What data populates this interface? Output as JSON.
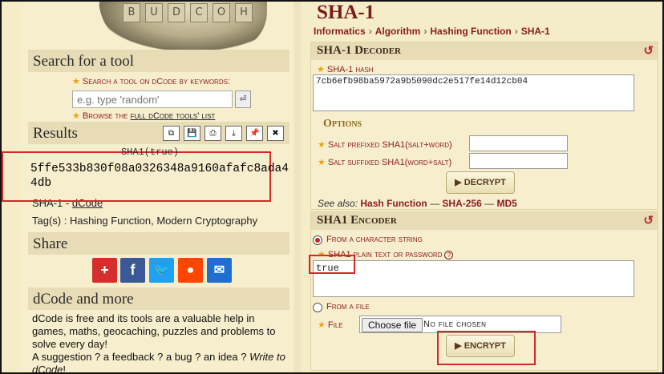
{
  "left": {
    "logo_letters": [
      "B",
      "U",
      "D",
      "C",
      "O",
      "H"
    ],
    "search_title": "Search for a tool",
    "search_hint": "Search a tool on dCode by keywords:",
    "search_placeholder": "e.g. type 'random'",
    "browse_prefix": "Browse the",
    "browse_link": "full dCode tools' list",
    "results_title": "Results",
    "result_label": "SHA1(true)",
    "result_value": "5ffe533b830f08a0326348a9160afafc8ada44db",
    "source_prefix": "SHA-1 -",
    "source_link": "dCode",
    "tags_text": "Tag(s) : Hashing Function, Modern Cryptography",
    "share_title": "Share",
    "about_title": "dCode and more",
    "about_text_1": "dCode is free and its tools are a valuable help in games, maths, geocaching, puzzles and problems to solve every day!",
    "about_text_2a": "A suggestion ? a feedback ? a bug ? an idea ?",
    "about_text_2b": "Write to dCode",
    "about_text_2c": "!"
  },
  "right": {
    "page_title": "SHA-1",
    "breadcrumb": [
      "Informatics",
      "Algorithm",
      "Hashing Function",
      "SHA-1"
    ],
    "decoder": {
      "title": "SHA-1 Decoder",
      "hash_label": "SHA-1 hash",
      "hash_value": "7cb6efb98ba5972a9b5090dc2e517fe14d12cb04",
      "options_title": "Options",
      "salt_prefix_label": "Salt prefixed SHA1(salt+word)",
      "salt_suffix_label": "Salt suffixed SHA1(word+salt)",
      "decrypt_label": "DECRYPT",
      "see_also_prefix": "See also:",
      "see_also": [
        "Hash Function",
        "SHA-256",
        "MD5"
      ],
      "see_also_sep": "—"
    },
    "encoder": {
      "title": "SHA1 Encoder",
      "from_string_label": "From a character string",
      "plain_label": "SHA1 plain text or password",
      "plain_value": "true",
      "from_file_label": "From a file",
      "file_label": "File",
      "choose_file_label": "Choose file",
      "no_file_label": "No file chosen",
      "encrypt_label": "ENCRYPT"
    }
  },
  "icons": {
    "copy": "⧉",
    "save": "💾",
    "print": "⎙",
    "download": "⤓",
    "pin": "📌",
    "close": "✖",
    "return": "⏎",
    "reset": "↺",
    "play": "▶"
  },
  "colors": {
    "accent": "#8b1c1c",
    "highlight": "#d42a2a",
    "panel_bg": "#f7eecd",
    "header_bg": "#e7dcb6",
    "share_plus": "#d62d2d",
    "share_facebook": "#3b5998",
    "share_twitter": "#1da1f2",
    "share_reddit": "#ff4500",
    "share_mail": "#1e6fd0"
  }
}
